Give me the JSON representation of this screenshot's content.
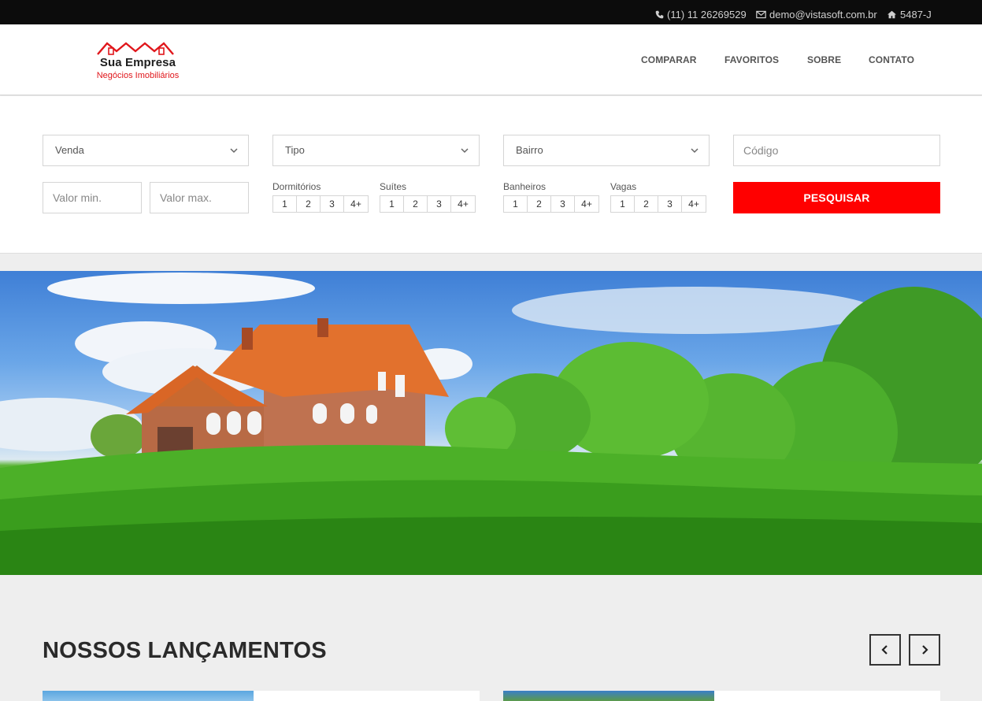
{
  "topbar": {
    "phone": "(11) 11 26269529",
    "email": "demo@vistasoft.com.br",
    "creci": "5487-J",
    "icons": [
      "phone-icon",
      "envelope-icon",
      "home-icon"
    ]
  },
  "logo": {
    "name": "Sua Empresa",
    "tagline": "Negócios Imobiliários"
  },
  "nav": {
    "items": [
      {
        "label": "COMPARAR"
      },
      {
        "label": "FAVORITOS"
      },
      {
        "label": "SOBRE"
      },
      {
        "label": "CONTATO"
      }
    ]
  },
  "search": {
    "finalidade": "Venda",
    "tipo": "Tipo",
    "bairro": "Bairro",
    "codigo_placeholder": "Código",
    "valor_min_placeholder": "Valor min.",
    "valor_max_placeholder": "Valor max.",
    "groups": [
      {
        "label": "Dormitórios",
        "options": [
          "1",
          "2",
          "3",
          "4+"
        ]
      },
      {
        "label": "Suítes",
        "options": [
          "1",
          "2",
          "3",
          "4+"
        ]
      },
      {
        "label": "Banheiros",
        "options": [
          "1",
          "2",
          "3",
          "4+"
        ]
      },
      {
        "label": "Vagas",
        "options": [
          "1",
          "2",
          "3",
          "4+"
        ]
      }
    ],
    "submit_label": "PESQUISAR"
  },
  "section": {
    "title": "NOSSOS LANÇAMENTOS"
  },
  "colors": {
    "accent": "#ff0000",
    "topbar_bg": "#0c0c0c",
    "logo_red": "#e0161b"
  }
}
